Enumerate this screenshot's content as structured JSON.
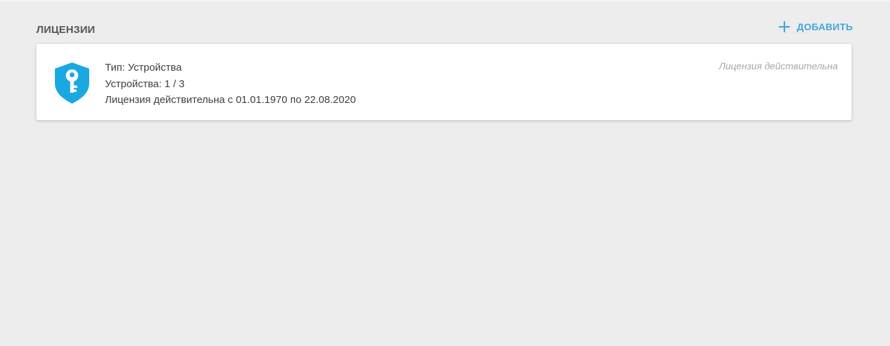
{
  "section": {
    "title": "ЛИЦЕНЗИИ",
    "add_label": "ДОБАВИТЬ"
  },
  "colors": {
    "accent": "#42a5dc",
    "icon": "#1aa8e0",
    "background": "#ededed"
  },
  "licenses": [
    {
      "icon": "shield-key-icon",
      "type_line": "Тип: Устройства",
      "devices_line": "Устройства: 1 / 3",
      "validity_line": "Лицензия действительна с 01.01.1970 по 22.08.2020",
      "status": "Лицензия действительна"
    }
  ]
}
